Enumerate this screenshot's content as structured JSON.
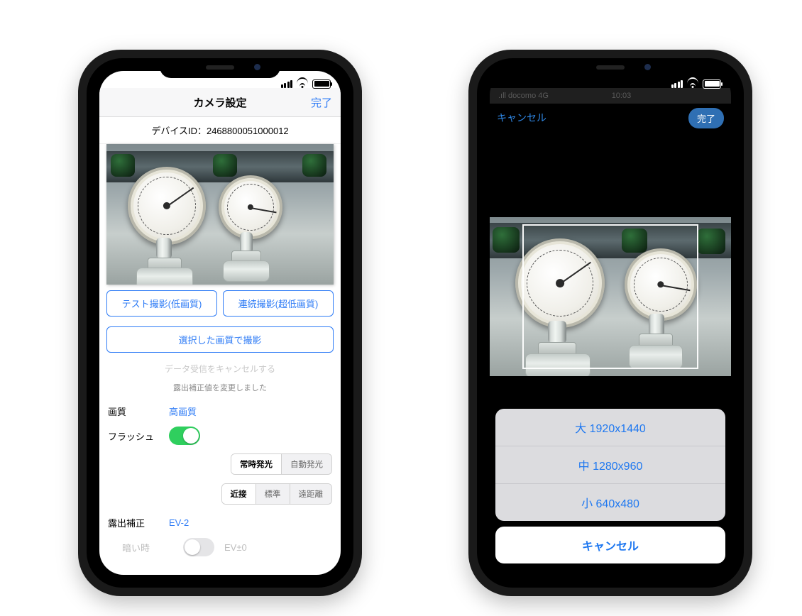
{
  "left": {
    "nav": {
      "title": "カメラ設定",
      "done": "完了"
    },
    "device": {
      "label": "デバイスID：",
      "value": "2468800051000012"
    },
    "buttons": {
      "testShot": "テスト撮影(低画質)",
      "burstShot": "連続撮影(超低画質)",
      "shootSelected": "選択した画質で撮影"
    },
    "cancelReceive": "データ受信をキャンセルする",
    "exposureChanged": "露出補正値を変更しました",
    "quality": {
      "label": "画質",
      "value": "高画質"
    },
    "flash": {
      "label": "フラッシュ",
      "on": true,
      "mode": {
        "options": [
          "常時発光",
          "自動発光"
        ],
        "selected": 0
      }
    },
    "focus": {
      "options": [
        "近接",
        "標準",
        "遠距離"
      ],
      "selected": 0
    },
    "exposure": {
      "label": "露出補正",
      "value": "EV-2"
    },
    "dark": {
      "label": "暗い時",
      "on": false,
      "value": "EV±0"
    }
  },
  "right": {
    "dimTime": "10:03",
    "dimCarrier": ".ıll docomo 4G",
    "nav": {
      "cancel": "キャンセル",
      "done": "完了"
    },
    "sheet": {
      "options": [
        {
          "label": "大 1920x1440"
        },
        {
          "label": "中 1280x960"
        },
        {
          "label": "小 640x480"
        }
      ],
      "cancel": "キャンセル"
    }
  }
}
